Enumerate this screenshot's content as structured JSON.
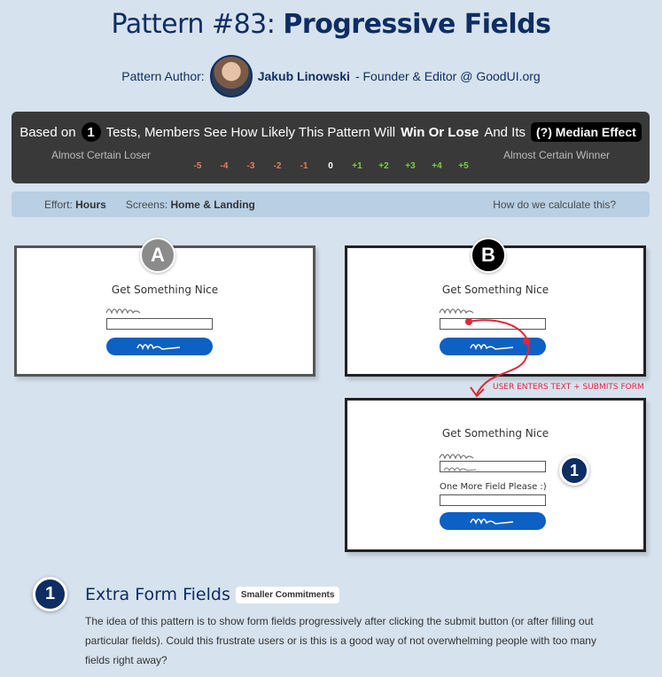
{
  "title": {
    "prefix": "Pattern #83: ",
    "bold": "Progressive Fields"
  },
  "author": {
    "label": "Pattern Author:",
    "name": "Jakub Linowski",
    "role": "- Founder & Editor @ GoodUI.org"
  },
  "score": {
    "based_on": "Based on",
    "tests_count": "1",
    "tests_text": "Tests, Members See How Likely This Pattern Will",
    "win_lose": "Win Or Lose",
    "and_its": "And Its",
    "median_label": "(?) Median Effect",
    "loser_label": "Almost Certain Loser",
    "winner_label": "Almost Certain Winner",
    "scale": [
      "-5",
      "-4",
      "-3",
      "-2",
      "-1",
      "0",
      "+1",
      "+2",
      "+3",
      "+4",
      "+5"
    ]
  },
  "info": {
    "effort_label": "Effort:",
    "effort_value": "Hours",
    "screens_label": "Screens:",
    "screens_value": "Home & Landing",
    "how_link": "How do we calculate this?"
  },
  "variants": {
    "a": {
      "badge": "A",
      "title": "Get Something Nice"
    },
    "b": {
      "badge": "B",
      "title": "Get Something Nice"
    },
    "b2": {
      "title": "Get Something Nice",
      "extra_label": "One More Field Please :)",
      "badge": "1"
    },
    "arrow_text": "USER ENTERS TEXT + SUBMITS FORM"
  },
  "section": {
    "number": "1",
    "title": "Extra Form Fields",
    "tag": "Smaller Commitments",
    "description": "The idea of this pattern is to show form fields progressively after clicking the submit button (or after filling out particular fields). Could this frustrate users or is this is a good way of not overwhelming people with too many fields right away?"
  },
  "colors": {
    "primary": "#0d2d63",
    "button": "#0d60c4",
    "arrow": "#e2263a",
    "negative": "#ec7a5b",
    "positive": "#7bcf47"
  }
}
